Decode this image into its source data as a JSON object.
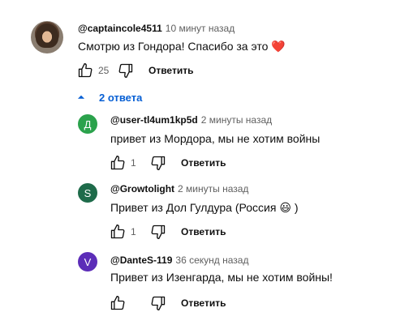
{
  "main_comment": {
    "author": "@captaincole4511",
    "time": "10 минут назад",
    "text": "Смотрю из Гондора! Спасибо за это",
    "emoji": "❤️",
    "likes": "25",
    "reply_label": "Ответить"
  },
  "replies_toggle": {
    "label": "2 ответа",
    "icon": "chevron-up-icon"
  },
  "replies": [
    {
      "avatar_letter": "Д",
      "avatar_color": "#2ba24c",
      "author": "@user-tl4um1kp5d",
      "time": "2 минуты назад",
      "text": "привет из Мордора, мы не хотим войны",
      "likes": "1",
      "reply_label": "Ответить"
    },
    {
      "avatar_letter": "S",
      "avatar_color": "#1e6b4a",
      "author": "@Growtolight",
      "time": "2 минуты назад",
      "text_before": "Привет из Дол Гулдура (Россия",
      "emoji": "😃",
      "text_after": ")",
      "likes": "1",
      "reply_label": "Ответить"
    },
    {
      "avatar_letter": "V",
      "avatar_color": "#5c2db8",
      "author": "@DanteS-119",
      "time": "36 секунд назад",
      "text": "Привет из Изенгарда, мы не хотим войны!",
      "likes": "",
      "reply_label": "Ответить"
    }
  ],
  "icons": {
    "like": "thumb-up-icon",
    "dislike": "thumb-down-icon"
  }
}
